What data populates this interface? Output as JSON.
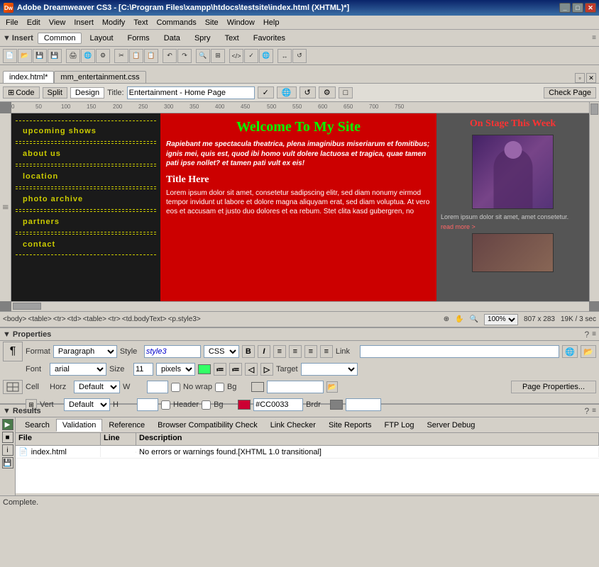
{
  "titlebar": {
    "title": "Adobe Dreamweaver CS3 - [C:\\Program Files\\xampp\\htdocs\\testsite\\index.html (XHTML)*]",
    "logo": "Dw"
  },
  "menubar": {
    "items": [
      "File",
      "Edit",
      "View",
      "Insert",
      "Modify",
      "Text",
      "Commands",
      "Site",
      "Window",
      "Help"
    ]
  },
  "insertbar": {
    "label": "▼ Insert",
    "tabs": [
      "Common",
      "Layout",
      "Forms",
      "Data",
      "Spry",
      "Text",
      "Favorites"
    ]
  },
  "doctabs": {
    "tabs": [
      {
        "label": "index.html*",
        "active": true
      },
      {
        "label": "mm_entertainment.css",
        "active": false
      }
    ]
  },
  "doctools": {
    "code_label": "Code",
    "split_label": "Split",
    "design_label": "Design",
    "title_label": "Title:",
    "title_value": "Entertainment - Home Page",
    "check_label": "Check Page"
  },
  "canvas": {
    "ruler_marks": [
      "0",
      "50",
      "100",
      "150",
      "200",
      "250",
      "300",
      "350",
      "400",
      "450",
      "500",
      "550",
      "600",
      "650",
      "700",
      "750"
    ]
  },
  "website": {
    "nav_items": [
      "upcoming shows",
      "about us",
      "location",
      "photo archive",
      "partners",
      "contact"
    ],
    "main_title": "Welcome To My Site",
    "main_body": "Rapiebant me spectacula theatrica, plena imaginibus miseriarum et fomitibus; ignis mei, quis est, quod ibi homo vult dolere lactuosa et tragica, quae tamen pati ipse nollet? et tamen pati vult ex eis!",
    "section_title": "Title Here",
    "section_body": "Lorem ipsum dolor sit amet, consetetur sadipscing elitr, sed diam nonumy eirmod tempor invidunt ut labore et dolore magna aliquyam erat, sed diam voluptua. At vero eos et accusam et justo duo dolores et ea rebum. Stet clita kasd gubergren, no",
    "sidebar_title": "On Stage This Week",
    "sidebar_text": "Lorem ipsum dolor sit amet, amet consetetur.",
    "sidebar_link": "read more >",
    "sidebar_text2": ""
  },
  "statusbar": {
    "path": "<body> <table> <tr> <td> <table> <tr> <td.bodyText> <p.style3>",
    "zoom": "100%",
    "dimensions": "807 x 283",
    "size": "19K / 3 sec"
  },
  "properties": {
    "panel_title": "Properties",
    "format_label": "Format",
    "format_value": "Paragraph",
    "style_label": "Style",
    "style_value": "style3",
    "css_btn": "CSS",
    "bold_btn": "B",
    "italic_btn": "I",
    "align_btns": [
      "≡",
      "≡",
      "≡",
      "≡"
    ],
    "link_label": "Link",
    "font_label": "Font",
    "font_value": "arial",
    "size_label": "Size",
    "size_value": "11",
    "size_unit": "pixels",
    "color_value": "#33FF66",
    "target_label": "Target",
    "cell_label": "Cell",
    "horz_label": "Horz",
    "horz_value": "Default",
    "w_label": "W",
    "nowrap_label": "No wrap",
    "bg_label": "Bg",
    "page_props_btn": "Page Properties...",
    "vert_label": "Vert",
    "vert_value": "Default",
    "h_label": "H",
    "header_label": "Header",
    "bg2_label": "Bg",
    "bg2_color": "#CC0033",
    "brdr_label": "Brdr"
  },
  "results": {
    "panel_title": "Results",
    "tabs": [
      "Search",
      "Validation",
      "Reference",
      "Browser Compatibility Check",
      "Link Checker",
      "Site Reports",
      "FTP Log",
      "Server Debug"
    ],
    "active_tab": "Validation",
    "columns": [
      "File",
      "Line",
      "Description"
    ],
    "rows": [
      {
        "icon": "📄",
        "file": "index.html",
        "line": "",
        "description": "No errors or warnings found.[XHTML 1.0 transitional]"
      }
    ]
  },
  "bottomstatus": {
    "text": "Complete."
  }
}
